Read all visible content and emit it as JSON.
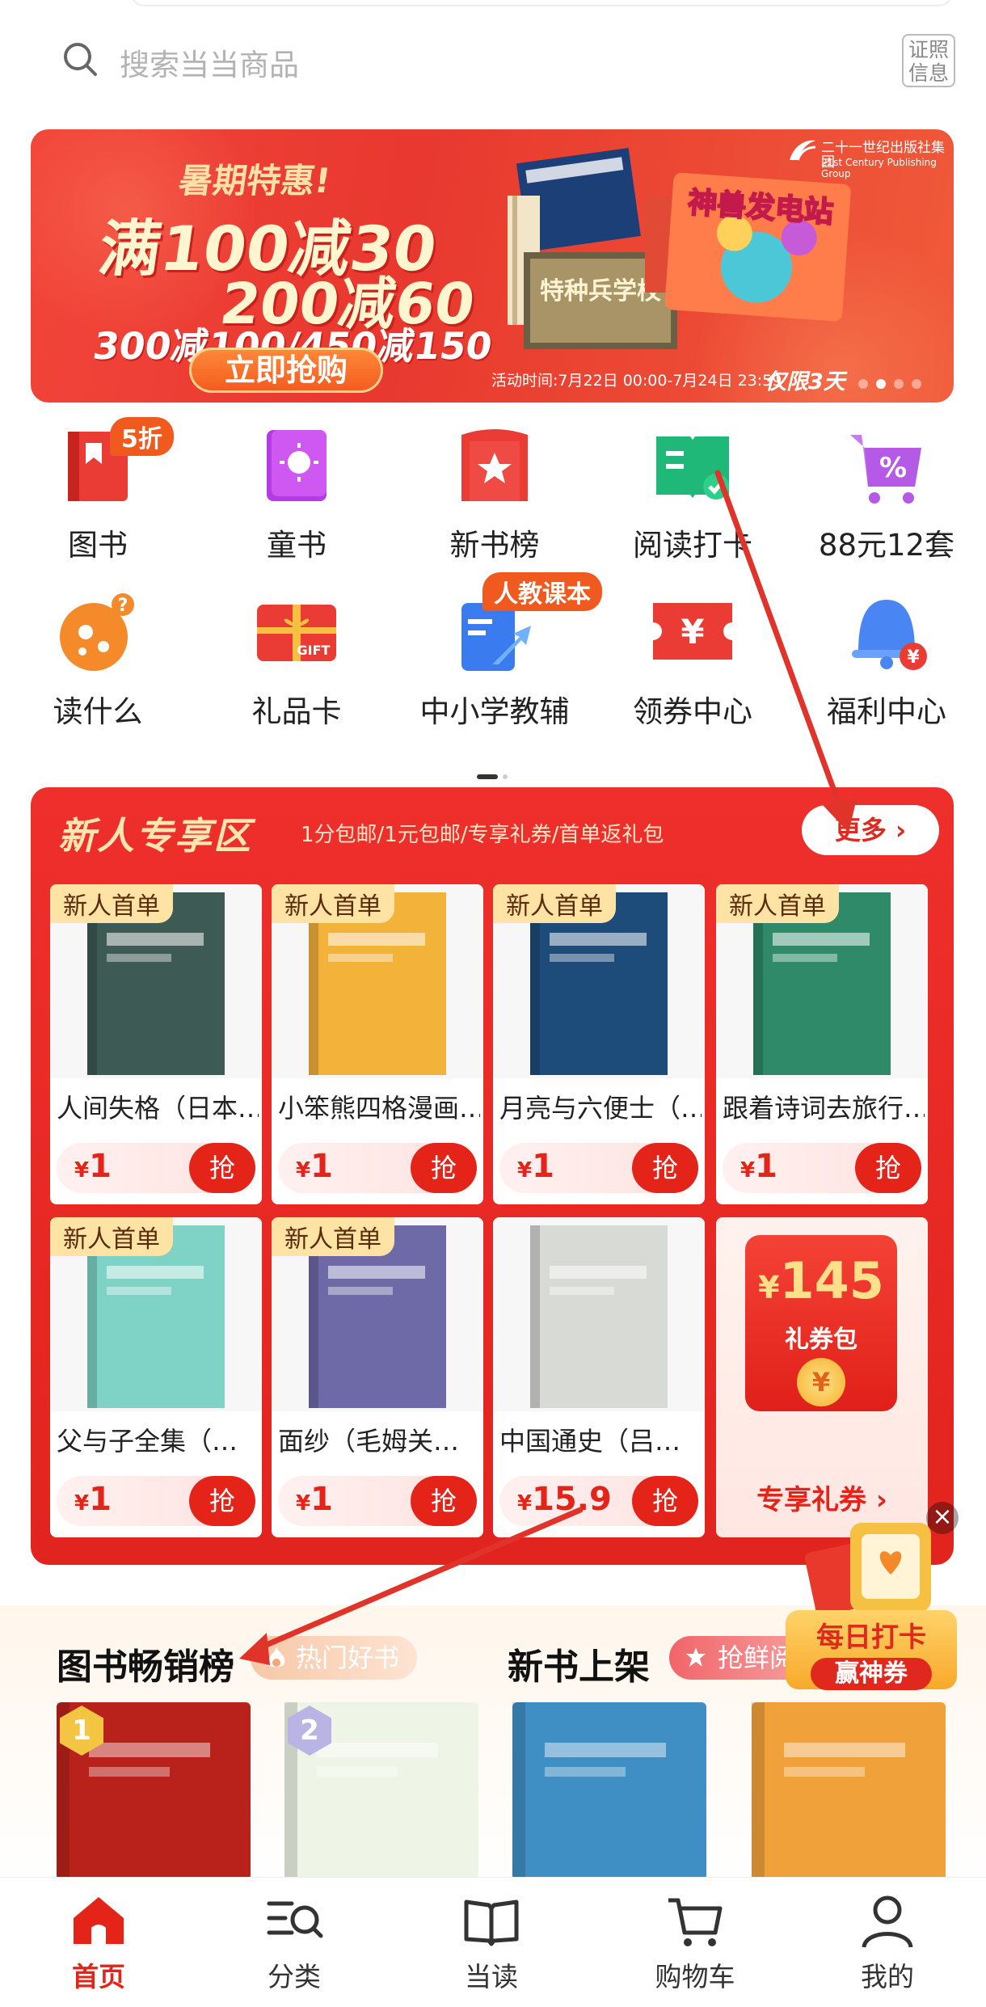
{
  "search": {
    "placeholder": "搜索当当商品",
    "license_label": "证照信息"
  },
  "banner": {
    "tag": "暑期特惠!",
    "line1": "满100减30",
    "line2": "200减60",
    "line3": "300减100/450减150",
    "cta": "立即抢购",
    "publisher": "二十一世纪出版社集团",
    "publisher_en": "21st Century Publishing Group",
    "book_left": "特种兵学校",
    "book_right": "神兽发电站",
    "time": "活动时间:7月22日 00:00-7月24日 23:59",
    "limit": "仅限3天",
    "page_count": 4,
    "active_page": 1
  },
  "categories": [
    {
      "label": "图书",
      "icon": "book-icon",
      "badge": "5折"
    },
    {
      "label": "童书",
      "icon": "kids-book-icon",
      "badge": ""
    },
    {
      "label": "新书榜",
      "icon": "new-ranking-icon",
      "badge": ""
    },
    {
      "label": "阅读打卡",
      "icon": "reading-checkin-icon",
      "badge": ""
    },
    {
      "label": "88元12套",
      "icon": "discount-cart-icon",
      "badge": ""
    },
    {
      "label": "读什么",
      "icon": "what-to-read-icon",
      "badge": ""
    },
    {
      "label": "礼品卡",
      "icon": "gift-card-icon",
      "badge": ""
    },
    {
      "label": "中小学教辅",
      "icon": "textbook-icon",
      "badge": "人教课本"
    },
    {
      "label": "领券中心",
      "icon": "coupon-icon",
      "badge": ""
    },
    {
      "label": "福利中心",
      "icon": "bell-icon",
      "badge": ""
    }
  ],
  "newcomer": {
    "title": "新人专享区",
    "subtitle": "1分包邮/1元包邮/专享礼券/首单返礼包",
    "more": "更多",
    "tag": "新人首单",
    "grab": "抢",
    "products": [
      {
        "name": "人间失格（日本…",
        "price": "1",
        "tag": true,
        "cover": "#3e5a55"
      },
      {
        "name": "小笨熊四格漫画…",
        "price": "1",
        "tag": true,
        "cover": "#f3b23a"
      },
      {
        "name": "月亮与六便士（…",
        "price": "1",
        "tag": true,
        "cover": "#1e4c7a"
      },
      {
        "name": "跟着诗词去旅行…",
        "price": "1",
        "tag": true,
        "cover": "#2f8a6a"
      },
      {
        "name": "父与子全集（…",
        "price": "1",
        "tag": true,
        "cover": "#7fd3c6"
      },
      {
        "name": "面纱（毛姆关…",
        "price": "1",
        "tag": true,
        "cover": "#6e6aa8"
      },
      {
        "name": "中国通史（吕…",
        "price": "15.9",
        "tag": false,
        "cover": "#d8dad6"
      }
    ],
    "coupon": {
      "currency": "¥",
      "amount": "145",
      "label": "礼券包",
      "link": "专享礼券"
    }
  },
  "lists": {
    "bestseller_title": "图书畅销榜",
    "bestseller_tag": "热门好书",
    "newbook_title": "新书上架",
    "newbook_tag": "抢鲜阅读",
    "books": [
      {
        "cover": "#b8221b",
        "rank": "1"
      },
      {
        "cover": "#eef4e6",
        "rank": "2"
      },
      {
        "cover": "#3f8fc4",
        "rank": ""
      },
      {
        "cover": "#f1a13a",
        "rank": ""
      }
    ]
  },
  "checkin": {
    "line1": "每日打卡",
    "line2": "赢神券"
  },
  "tabbar": [
    {
      "label": "首页",
      "icon": "home-icon",
      "active": true
    },
    {
      "label": "分类",
      "icon": "category-icon",
      "active": false
    },
    {
      "label": "当读",
      "icon": "reading-icon",
      "active": false
    },
    {
      "label": "购物车",
      "icon": "cart-icon",
      "active": false
    },
    {
      "label": "我的",
      "icon": "profile-icon",
      "active": false
    }
  ],
  "colors": {
    "brand": "#e42419",
    "price": "#e42419",
    "tag_bg": "#ffe3a4"
  }
}
